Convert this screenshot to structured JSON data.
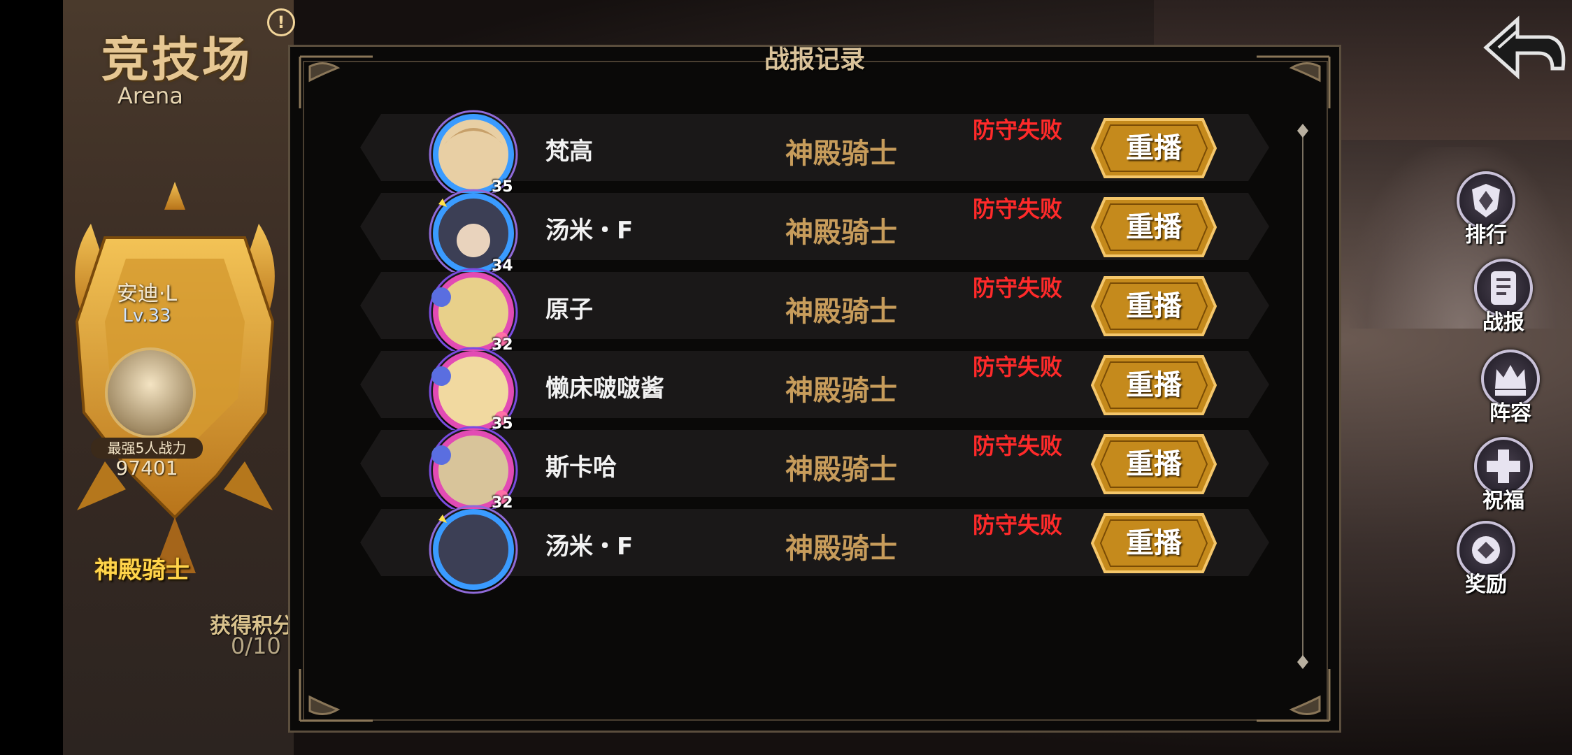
{
  "arena": {
    "title": "竞技场",
    "subtitle": "Arena",
    "info_icon": "!"
  },
  "player": {
    "name": "安迪·L",
    "level": "Lv.33",
    "power_label": "最强5人战力",
    "power_value": "97401",
    "rank_title": "神殿骑士",
    "score_label": "获得积分",
    "score_value": "0/10"
  },
  "dialog": {
    "title": "战报记录"
  },
  "records": [
    {
      "name": "梵高",
      "level": "35",
      "rank": "神殿骑士",
      "result": "防守失败",
      "replay_label": "重播",
      "avatar_color": "#e8cfa4",
      "frame": "blue"
    },
    {
      "name": "汤米・F",
      "level": "34",
      "rank": "神殿骑士",
      "result": "防守失败",
      "replay_label": "重播",
      "avatar_color": "#3c3f55",
      "frame": "blue"
    },
    {
      "name": "原子",
      "level": "32",
      "rank": "神殿骑士",
      "result": "防守失败",
      "replay_label": "重播",
      "avatar_color": "#e8d08a",
      "frame": "pink"
    },
    {
      "name": "懒床啵啵酱",
      "level": "35",
      "rank": "神殿骑士",
      "result": "防守失败",
      "replay_label": "重播",
      "avatar_color": "#f1d9a0",
      "frame": "pink"
    },
    {
      "name": "斯卡哈",
      "level": "32",
      "rank": "神殿骑士",
      "result": "防守失败",
      "replay_label": "重播",
      "avatar_color": "#d8c49a",
      "frame": "pink"
    },
    {
      "name": "汤米・F",
      "level": "",
      "rank": "神殿骑士",
      "result": "防守失败",
      "replay_label": "重播",
      "avatar_color": "#3c3f55",
      "frame": "blue"
    }
  ],
  "side_menu": [
    {
      "label": "排行",
      "icon": "ranking-shield-icon"
    },
    {
      "label": "战报",
      "icon": "battle-report-scroll-icon"
    },
    {
      "label": "阵容",
      "icon": "lineup-crown-icon"
    },
    {
      "label": "祝福",
      "icon": "blessing-cross-icon"
    },
    {
      "label": "奖励",
      "icon": "reward-orb-icon"
    }
  ],
  "colors": {
    "result_red": "#ff2a2a",
    "rank_gold": "#c79c5b",
    "replay_gold": "#c58a1c",
    "title_text": "#d9c29a"
  }
}
